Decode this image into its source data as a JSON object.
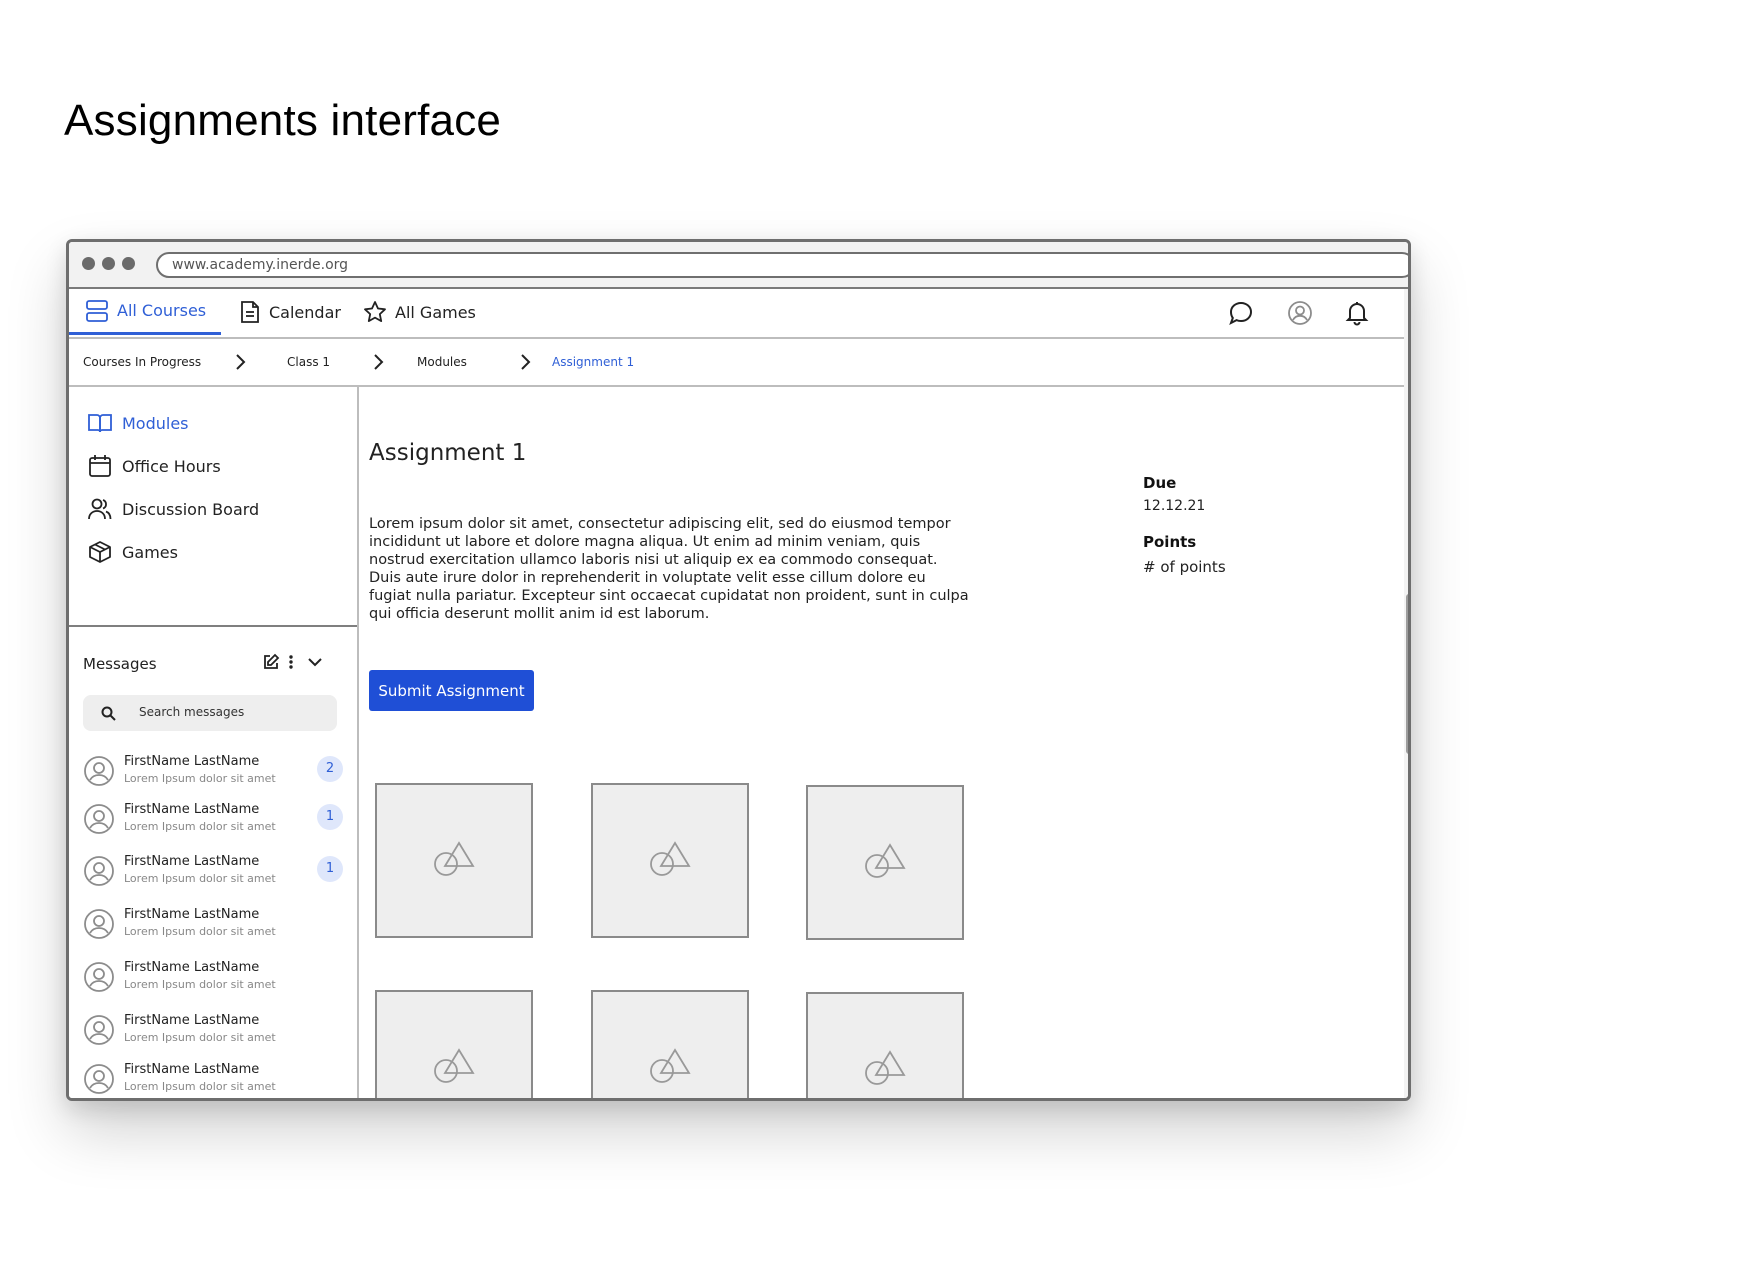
{
  "page_title": "Assignments interface",
  "browser": {
    "url": "www.academy.inerde.org"
  },
  "topnav": {
    "tabs": [
      {
        "label": "All Courses",
        "icon": "courses-icon",
        "active": true
      },
      {
        "label": "Calendar",
        "icon": "document-icon",
        "active": false
      },
      {
        "label": "All Games",
        "icon": "star-icon",
        "active": false
      }
    ],
    "right_icons": [
      "chat-icon",
      "user-icon",
      "bell-icon"
    ]
  },
  "breadcrumb": {
    "items": [
      "Courses In Progress",
      "Class 1",
      "Modules",
      "Assignment 1"
    ]
  },
  "sidebar": {
    "items": [
      {
        "label": "Modules",
        "icon": "book-icon",
        "active": true
      },
      {
        "label": "Office Hours",
        "icon": "calendar-icon",
        "active": false
      },
      {
        "label": "Discussion Board",
        "icon": "users-icon",
        "active": false
      },
      {
        "label": "Games",
        "icon": "cube-icon",
        "active": false
      }
    ]
  },
  "messages": {
    "title": "Messages",
    "search_placeholder": "Search messages",
    "list": [
      {
        "name": "FirstName LastName",
        "preview": "Lorem Ipsum dolor sit amet",
        "badge": "2"
      },
      {
        "name": "FirstName LastName",
        "preview": "Lorem Ipsum dolor sit amet",
        "badge": "1"
      },
      {
        "name": "FirstName LastName",
        "preview": "Lorem Ipsum dolor sit amet",
        "badge": "1"
      },
      {
        "name": "FirstName LastName",
        "preview": "Lorem Ipsum dolor sit amet",
        "badge": ""
      },
      {
        "name": "FirstName LastName",
        "preview": "Lorem Ipsum dolor sit amet",
        "badge": ""
      },
      {
        "name": "FirstName LastName",
        "preview": "Lorem Ipsum dolor sit amet",
        "badge": ""
      },
      {
        "name": "FirstName LastName",
        "preview": "Lorem Ipsum dolor sit amet",
        "badge": ""
      }
    ]
  },
  "assignment": {
    "title": "Assignment 1",
    "description": "Lorem ipsum dolor sit amet, consectetur adipiscing elit, sed do eiusmod tempor incididunt ut labore et dolore magna aliqua. Ut enim ad minim veniam, quis nostrud exercitation ullamco laboris nisi ut aliquip ex ea commodo consequat. Duis aute irure dolor in reprehenderit in voluptate velit esse cillum dolore eu fugiat nulla pariatur. Excepteur sint occaecat cupidatat non proident, sunt in culpa qui officia deserunt mollit anim id est laborum.",
    "submit_label": "Submit Assignment",
    "due_label": "Due",
    "due_value": "12.12.21",
    "points_label": "Points",
    "points_value": "# of points",
    "image_placeholders": 6
  },
  "colors": {
    "accent": "#2f5fd6",
    "button": "#1f4fd6",
    "badge_bg": "#dfe7fb"
  }
}
